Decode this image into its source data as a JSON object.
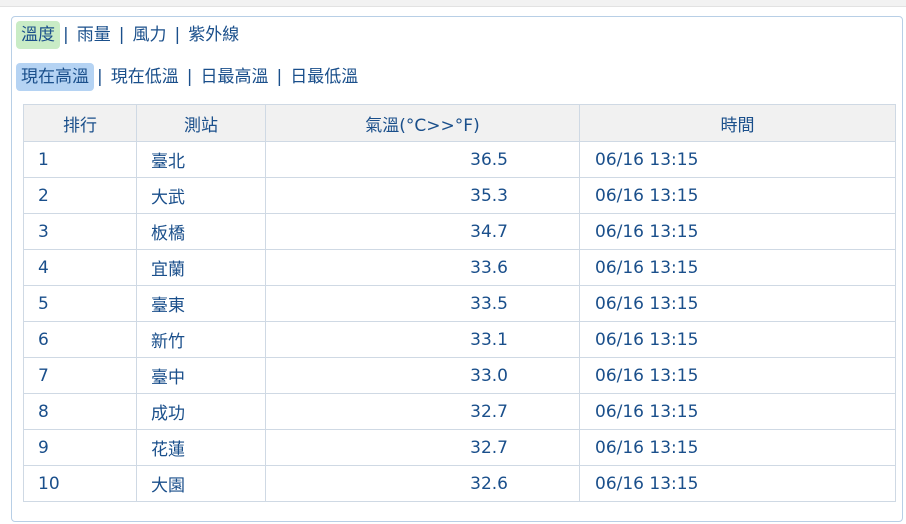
{
  "category_tabs": [
    {
      "label": "溫度",
      "active": true
    },
    {
      "label": "雨量",
      "active": false
    },
    {
      "label": "風力",
      "active": false
    },
    {
      "label": "紫外線",
      "active": false
    }
  ],
  "sub_tabs": [
    {
      "label": "現在高溫",
      "active": true
    },
    {
      "label": "現在低溫",
      "active": false
    },
    {
      "label": "日最高溫",
      "active": false
    },
    {
      "label": "日最低溫",
      "active": false
    }
  ],
  "separator": "|",
  "table": {
    "headers": [
      "排行",
      "測站",
      "氣溫(°C>>°F)",
      "時間"
    ],
    "rows": [
      [
        "1",
        "臺北",
        "36.5",
        "06/16 13:15"
      ],
      [
        "2",
        "大武",
        "35.3",
        "06/16 13:15"
      ],
      [
        "3",
        "板橋",
        "34.7",
        "06/16 13:15"
      ],
      [
        "4",
        "宜蘭",
        "33.6",
        "06/16 13:15"
      ],
      [
        "5",
        "臺東",
        "33.5",
        "06/16 13:15"
      ],
      [
        "6",
        "新竹",
        "33.1",
        "06/16 13:15"
      ],
      [
        "7",
        "臺中",
        "33.0",
        "06/16 13:15"
      ],
      [
        "8",
        "成功",
        "32.7",
        "06/16 13:15"
      ],
      [
        "9",
        "花蓮",
        "32.7",
        "06/16 13:15"
      ],
      [
        "10",
        "大園",
        "32.6",
        "06/16 13:15"
      ]
    ]
  }
}
